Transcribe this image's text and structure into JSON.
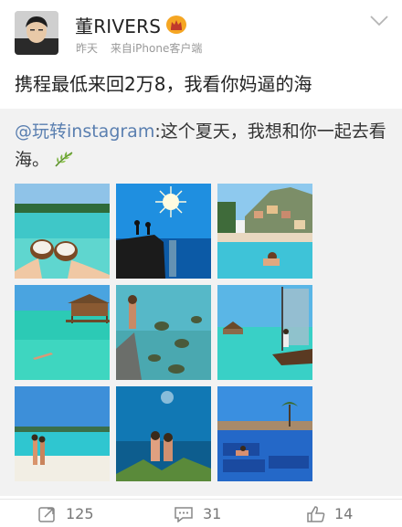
{
  "user": {
    "name": "董RIVERS",
    "badge_icon": "crown-vip-icon",
    "time": "昨天",
    "source": "来自iPhone客户端"
  },
  "post": {
    "text": "携程最低来回2万8，我看你妈逼的海"
  },
  "repost": {
    "mention": "@玩转instagram",
    "text": ":这个夏天，我想和你一起去看海。",
    "emoji_icon": "palm-leaf-icon"
  },
  "photos": [
    {
      "name": "coconut-beach-photo"
    },
    {
      "name": "sun-cliff-photo"
    },
    {
      "name": "cliff-town-pool-photo"
    },
    {
      "name": "overwater-bungalow-photo"
    },
    {
      "name": "turtles-reef-photo"
    },
    {
      "name": "sailboat-lagoon-photo"
    },
    {
      "name": "couple-beach-photo"
    },
    {
      "name": "underwater-couple-photo"
    },
    {
      "name": "resort-pool-photo"
    }
  ],
  "actions": {
    "repost_count": "125",
    "comment_count": "31",
    "like_count": "14"
  },
  "colors": {
    "mention": "#5a7fb0",
    "repost_bg": "#f2f2f2",
    "badge": "#f5a623"
  }
}
